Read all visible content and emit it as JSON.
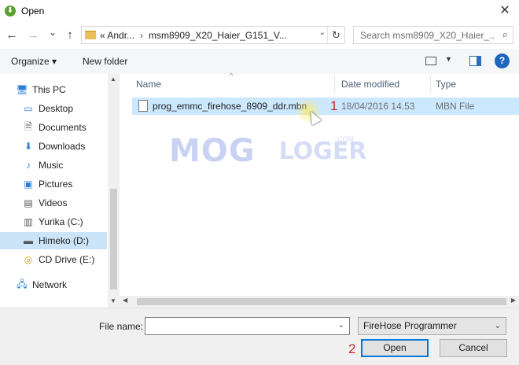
{
  "window": {
    "title": "Open",
    "close_glyph": "✕"
  },
  "nav": {
    "back_glyph": "←",
    "forward_glyph": "→",
    "recent_glyph": "⌄",
    "up_glyph": "↑",
    "breadcrumb": [
      "«  Andr...",
      "msm8909_X20_Haier_G151_V..."
    ],
    "breadcrumb_sep": "›",
    "refresh_glyph": "↻",
    "search_placeholder": "Search msm8909_X20_Haier_...",
    "search_glyph": "⌕"
  },
  "toolbar": {
    "organize_label": "Organize ▾",
    "new_folder_label": "New folder",
    "view_dd_glyph": "▼",
    "help_glyph": "?"
  },
  "sidebar": {
    "items": [
      {
        "label": "This PC",
        "icon": "computer-icon",
        "glyph": "🖥"
      },
      {
        "label": "Desktop",
        "icon": "desktop-icon",
        "glyph": "▭"
      },
      {
        "label": "Documents",
        "icon": "documents-icon",
        "glyph": "🗎"
      },
      {
        "label": "Downloads",
        "icon": "downloads-icon",
        "glyph": "⬇"
      },
      {
        "label": "Music",
        "icon": "music-icon",
        "glyph": "♪"
      },
      {
        "label": "Pictures",
        "icon": "pictures-icon",
        "glyph": "▣"
      },
      {
        "label": "Videos",
        "icon": "videos-icon",
        "glyph": "▤"
      },
      {
        "label": "Yurika (C:)",
        "icon": "drive-icon",
        "glyph": "▥"
      },
      {
        "label": "Himeko (D:)",
        "icon": "drive-icon",
        "glyph": "▬"
      },
      {
        "label": "CD Drive (E:)",
        "icon": "cd-drive-icon",
        "glyph": "◎"
      },
      {
        "label": "Network",
        "icon": "network-icon",
        "glyph": "🖧"
      }
    ],
    "selected_index": 8,
    "scroll_up_glyph": "▲",
    "scroll_down_glyph": "▼"
  },
  "columns": {
    "name": "Name",
    "date": "Date modified",
    "type": "Type",
    "sort_glyph": "^"
  },
  "files": [
    {
      "name": "prog_emmc_firehose_8909_ddr.mbn",
      "date": "18/04/2016 14.53",
      "type": "MBN File"
    }
  ],
  "markers": {
    "one": "1",
    "two": "2"
  },
  "watermark": {
    "left": "MOG",
    "right": "LOGER",
    "suffix": ".COM"
  },
  "hscroll": {
    "left_glyph": "◀",
    "right_glyph": "▶"
  },
  "bottom": {
    "file_name_label": "File name:",
    "file_name_value": "",
    "file_name_dd_glyph": "⌄",
    "filter_value": "FireHose Programmer",
    "filter_dd_glyph": "⌄",
    "open_label": "Open",
    "cancel_label": "Cancel"
  }
}
